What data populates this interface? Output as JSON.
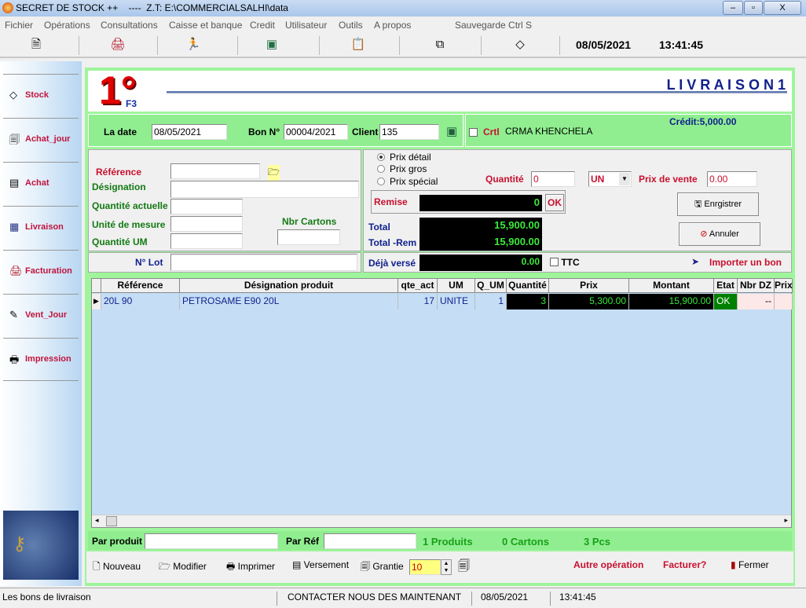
{
  "window": {
    "title": "SECRET DE STOCK ++    ----  Z.T: E:\\COMMERCIALSALHI\\data",
    "minimize": "–",
    "restore": "▫",
    "close": "X"
  },
  "menu": [
    "Fichier",
    "Opérations",
    "Consultations",
    "Caisse et banque",
    "Credit",
    "Utilisateur",
    "Outils",
    "A propos",
    "Sauvegarde Ctrl S"
  ],
  "toolbar": {
    "icons": [
      "document-icon",
      "printer-icon",
      "runner-icon",
      "exit-icon",
      "notes-icon",
      "copy-icon",
      "book-icon"
    ],
    "date": "08/05/2021",
    "time": "13:41:45"
  },
  "sidebar": [
    {
      "label": "Stock",
      "icon": "book-icon"
    },
    {
      "label": "Achat_jour",
      "icon": "report-icon"
    },
    {
      "label": "Achat",
      "icon": "notepad-icon"
    },
    {
      "label": "Livraison",
      "icon": "calendar-icon"
    },
    {
      "label": "Facturation",
      "icon": "printer-icon"
    },
    {
      "label": "Vent_Jour",
      "icon": "paint-icon"
    },
    {
      "label": "Impression",
      "icon": "print-icon"
    }
  ],
  "header": {
    "number": "1°",
    "shortcut": "F3",
    "title": "L I V R A I S O N 1"
  },
  "top": {
    "date_label": "La date",
    "date": "08/05/2021",
    "bon_label": "Bon N°",
    "bon": "00004/2021",
    "client_label": "Client",
    "client": "135",
    "crtl_label": "Crtl",
    "client_name": "CRMA KHENCHELA",
    "credit": "Crédit:5,000.00"
  },
  "form": {
    "reference": "Référence",
    "designation": "Désignation",
    "qte_actuelle": "Quantité actuelle",
    "unite": "Unité de mesure",
    "qte_um": "Quantité UM",
    "nbr_cartons": "Nbr Cartons",
    "lot": "N° Lot"
  },
  "pricing": {
    "options": [
      "Prix détail",
      "Prix gros",
      "Prix spécial"
    ],
    "selected": 0,
    "quantite_label": "Quantité",
    "quantite": "0",
    "unit": "UN",
    "prix_vente_label": "Prix de vente",
    "prix_vente": "0.00",
    "remise_label": "Remise",
    "remise": "0",
    "ok": "OK",
    "total_label": "Total",
    "total": "15,900.00",
    "total_rem_label": "Total -Rem",
    "total_rem": "15,900.00",
    "verse_label": "Déjà versé",
    "verse": "0.00",
    "ttc": "TTC",
    "enregistrer": "Enrgistrer",
    "annuler": "Annuler",
    "importer": "Importer un bon"
  },
  "grid": {
    "columns": [
      "Référence",
      "Désignation produit",
      "qte_act",
      "UM",
      "Q_UM",
      "Quantité",
      "Prix",
      "Montant",
      "Etat",
      "Nbr DZ",
      "Prix"
    ],
    "rows": [
      [
        "20L 90",
        "PETROSAME  E90 20L",
        "17",
        "UNITE",
        "1",
        "3",
        "5,300.00",
        "15,900.00",
        "OK",
        "--",
        ""
      ]
    ]
  },
  "filter": {
    "produit_label": "Par produit",
    "ref_label": "Par Réf",
    "produits": "1 Produits",
    "cartons": "0 Cartons",
    "pcs": "3 Pcs"
  },
  "bottom": {
    "nouveau": "Nouveau",
    "modifier": "Modifier",
    "imprimer": "Imprimer",
    "versement": "Versement",
    "grantie": "Grantie",
    "grantie_value": "10",
    "autre": "Autre opération",
    "facturer": "Facturer?",
    "fermer": "Fermer"
  },
  "status": {
    "left": "Les bons de livraison",
    "contact": "CONTACTER NOUS DES MAINTENANT",
    "date": "08/05/2021",
    "time": "13:41:45"
  }
}
